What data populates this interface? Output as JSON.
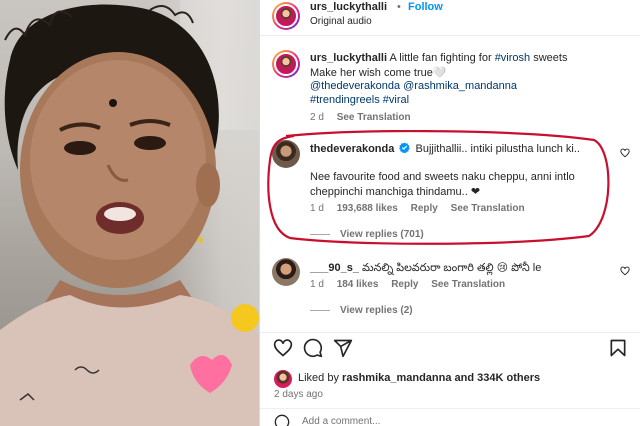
{
  "header": {
    "username": "urs_luckythalli",
    "separator": "•",
    "follow_label": "Follow",
    "audio": "Original audio"
  },
  "caption": {
    "username": "urs_luckythalli",
    "text_prefix": "A little fan fighting for",
    "hashtag1": "#virosh",
    "text_suffix": "sweets",
    "line2": "Make her wish come true🤍",
    "mentions": "@thedeverakonda @rashmika_mandanna",
    "hashtags": "#trendingreels #viral",
    "time": "2 d",
    "see_translation": "See Translation"
  },
  "comments": [
    {
      "username": "thedeverakonda",
      "verified": true,
      "line1": "Bujjithallii.. intiki pilustha lunch ki..",
      "line2": "Nee favourite food and sweets naku cheppu, anni intlo",
      "line3": "cheppinchi manchiga thindamu.. ❤",
      "time": "1 d",
      "likes": "193,688 likes",
      "reply": "Reply",
      "see_translation": "See Translation",
      "view_replies": "View replies (701)"
    },
    {
      "username": "___90_s_",
      "text": "మనల్ని పిలవరురా బంగారి తల్లి 😢 పోనీ le",
      "time": "1 d",
      "likes": "184 likes",
      "reply": "Reply",
      "see_translation": "See Translation",
      "view_replies": "View replies (2)"
    }
  ],
  "footer": {
    "liked_by_prefix": "Liked by",
    "liked_by_user": "rashmika_mandanna",
    "liked_by_suffix": "and 334K others",
    "time": "2 days ago",
    "add_comment_placeholder": "Add a comment..."
  },
  "icons": {
    "heart": "heart-icon",
    "comment": "comment-icon",
    "share": "share-icon",
    "save": "bookmark-icon",
    "verified": "verified-badge-icon"
  },
  "colors": {
    "link": "#00376b",
    "follow": "#0095f6",
    "verified": "#0095f6",
    "annotation": "#c8102e",
    "like_heart": "#ed4956"
  }
}
